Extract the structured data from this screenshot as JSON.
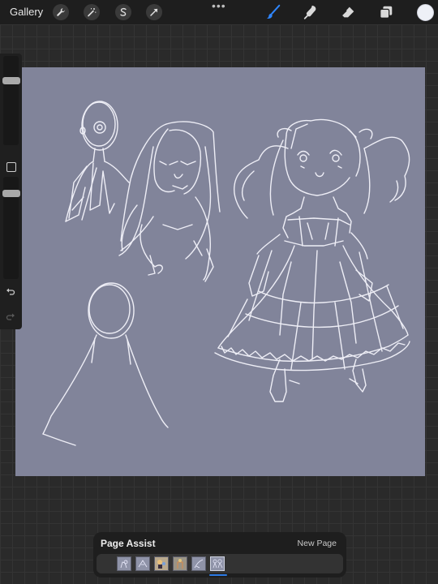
{
  "topbar": {
    "gallery_label": "Gallery",
    "left_tools": [
      "wrench-icon",
      "magic-wand-icon",
      "selection-s-icon",
      "transform-arrow-icon"
    ],
    "more_label": "•••",
    "right_tools": [
      "brush-icon",
      "smudge-icon",
      "eraser-icon",
      "layers-icon"
    ],
    "active_tool": "brush-icon",
    "current_color": "#eef0f7"
  },
  "sidebar": {
    "brush_size_level": 0.2,
    "opacity_level": 0.2,
    "undo_icon": "undo-icon",
    "redo_icon": "redo-icon"
  },
  "canvas": {
    "background": "#81849a"
  },
  "page_assist": {
    "title": "Page Assist",
    "new_page_label": "New Page",
    "page_count": 6,
    "selected_page": 6
  }
}
